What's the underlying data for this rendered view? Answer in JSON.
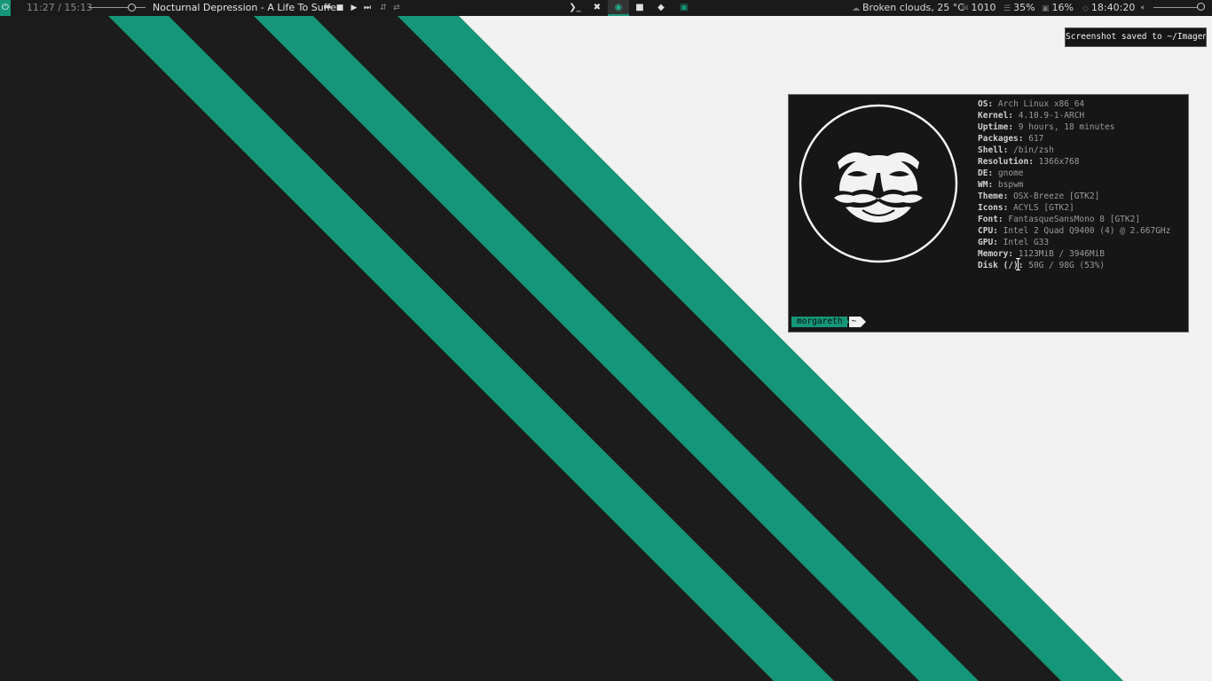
{
  "colors": {
    "accent": "#169679",
    "wallpaper_dark": "#1c1c1c",
    "wallpaper_light": "#f1f1f1",
    "bar_bg": "#1a1a1a"
  },
  "topbar": {
    "power_icon": "power-icon",
    "player": {
      "time": "11:27 / 15:13",
      "progress": 0.75,
      "title": "Nocturnal Depression - A Life To Suffer",
      "controls": [
        "previous-icon",
        "stop-icon",
        "play-icon",
        "next-icon",
        "repeat-icon",
        "shuffle-icon"
      ]
    },
    "workspaces": [
      {
        "icon": "terminal-icon",
        "glyph": "❯_"
      },
      {
        "icon": "crossed-tools-icon",
        "glyph": "✖"
      },
      {
        "icon": "github-cat-icon",
        "glyph": "◉",
        "active": true
      },
      {
        "icon": "video-camera-icon",
        "glyph": "■"
      },
      {
        "icon": "chat-bubble-icon",
        "glyph": "◆"
      },
      {
        "icon": "grid-app-icon",
        "glyph": "▣"
      }
    ],
    "weather": "Broken clouds, 25 °C",
    "mail": "1010",
    "ram": "35%",
    "cpu": "16%",
    "clock": "18:40:20",
    "volume": 1.0
  },
  "notification": "Screenshot saved to ~/Imagens",
  "terminal": {
    "info": [
      {
        "key": "OS:",
        "value": "Arch Linux x86_64"
      },
      {
        "key": "Kernel:",
        "value": "4.10.9-1-ARCH"
      },
      {
        "key": "Uptime:",
        "value": "9 hours, 18 minutes"
      },
      {
        "key": "Packages:",
        "value": "617"
      },
      {
        "key": "Shell:",
        "value": "/bin/zsh"
      },
      {
        "key": "Resolution:",
        "value": "1366x768"
      },
      {
        "key": "DE:",
        "value": "gnome"
      },
      {
        "key": "WM:",
        "value": "bspwm"
      },
      {
        "key": "Theme:",
        "value": "OSX-Breeze [GTK2]"
      },
      {
        "key": "Icons:",
        "value": "ACYLS [GTK2]"
      },
      {
        "key": "Font:",
        "value": "FantasqueSansMono 8 [GTK2]"
      },
      {
        "key": "CPU:",
        "value": "Intel 2 Quad Q9400 (4) @ 2.667GHz"
      },
      {
        "key": "GPU:",
        "value": "Intel G33"
      },
      {
        "key": "Memory:",
        "value": "1123MiB / 3946MiB"
      },
      {
        "key": "Disk (/):",
        "value": "50G / 98G (53%)"
      }
    ],
    "prompt_user": "morgareth",
    "prompt_dir": "~",
    "logo": "fsociety-mask-icon"
  }
}
